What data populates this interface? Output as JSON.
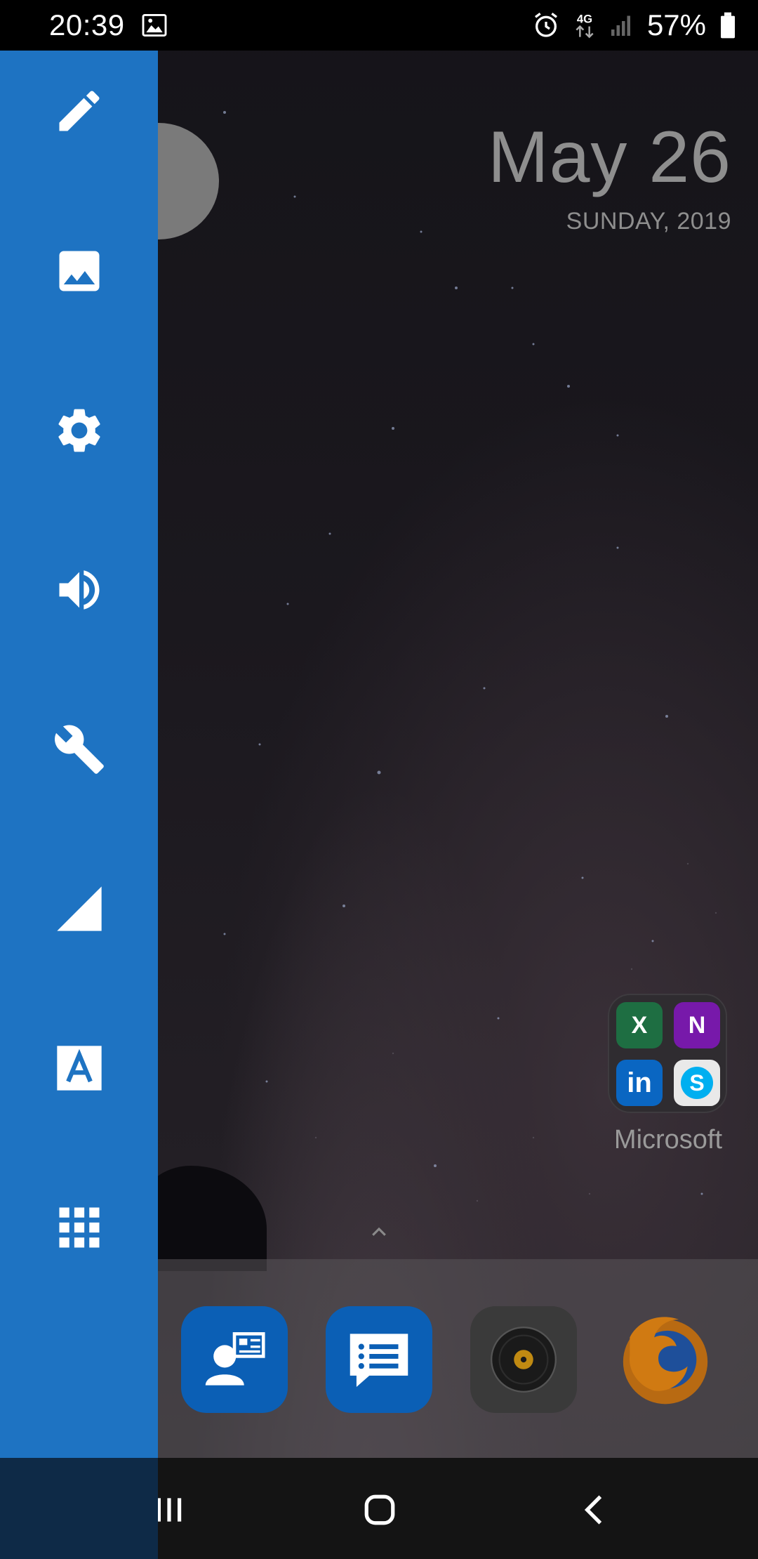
{
  "status_bar": {
    "time": "20:39",
    "network": "4G",
    "battery": "57%",
    "icons": [
      "image-icon",
      "alarm-icon",
      "data-4g-icon",
      "signal-icon",
      "battery-icon"
    ]
  },
  "clock_widget": {
    "date": "May 26",
    "day": "SUNDAY, 2019"
  },
  "sidebar": {
    "background": "#1e73c2",
    "items": [
      {
        "icon": "pencil-icon"
      },
      {
        "icon": "image-icon"
      },
      {
        "icon": "gear-icon"
      },
      {
        "icon": "volume-icon"
      },
      {
        "icon": "wrench-icon"
      },
      {
        "icon": "signal-icon"
      },
      {
        "icon": "font-icon"
      },
      {
        "icon": "apps-grid-icon"
      }
    ]
  },
  "folder": {
    "label": "Microsoft",
    "apps": [
      {
        "icon": "excel-icon",
        "letter": "X",
        "color": "#1e6e42"
      },
      {
        "icon": "onenote-icon",
        "letter": "N",
        "color": "#7719aa"
      },
      {
        "icon": "linkedin-icon",
        "letter": "in",
        "color": "#0a66c2"
      },
      {
        "icon": "skype-icon",
        "letter": "S",
        "color": "#00aff0"
      }
    ]
  },
  "dock": {
    "apps": [
      {
        "icon": "contacts-icon",
        "color": "#0b5fb5"
      },
      {
        "icon": "messages-icon",
        "color": "#0b5fb5"
      },
      {
        "icon": "music-player-icon",
        "color": "#3a3a3a"
      },
      {
        "icon": "firefox-icon",
        "color": "#e66000"
      }
    ]
  },
  "navigation": {
    "buttons": [
      "recent-apps-icon",
      "home-icon",
      "back-icon"
    ]
  }
}
